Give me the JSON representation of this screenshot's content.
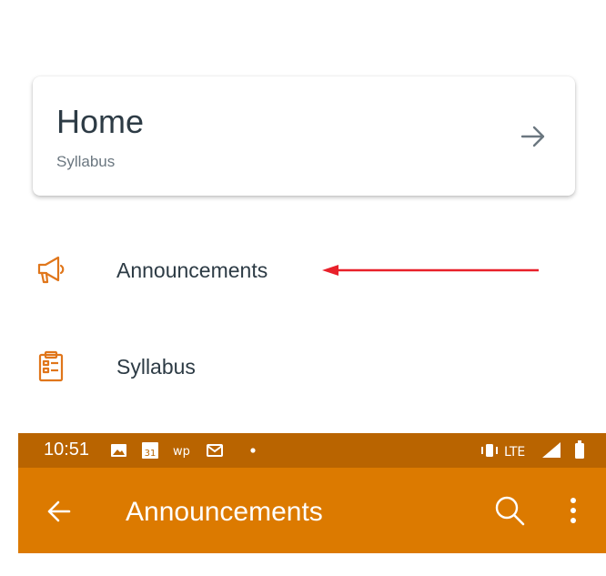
{
  "card": {
    "title": "Home",
    "subtitle": "Syllabus",
    "icon": "arrow-right-icon"
  },
  "nav": [
    {
      "label": "Announcements",
      "icon": "megaphone-icon"
    },
    {
      "label": "Syllabus",
      "icon": "clipboard-icon"
    }
  ],
  "annotation": {
    "color": "#e8202a"
  },
  "status_bar": {
    "time": "10:51",
    "network": "LTE"
  },
  "app_bar": {
    "title": "Announcements",
    "back_icon": "back-arrow-icon",
    "search_icon": "search-icon",
    "menu_icon": "overflow-menu-icon"
  },
  "colors": {
    "accent": "#dc7a00",
    "status_bar": "#b96400",
    "nav_icon": "#e0761b",
    "text": "#2d3b45"
  }
}
